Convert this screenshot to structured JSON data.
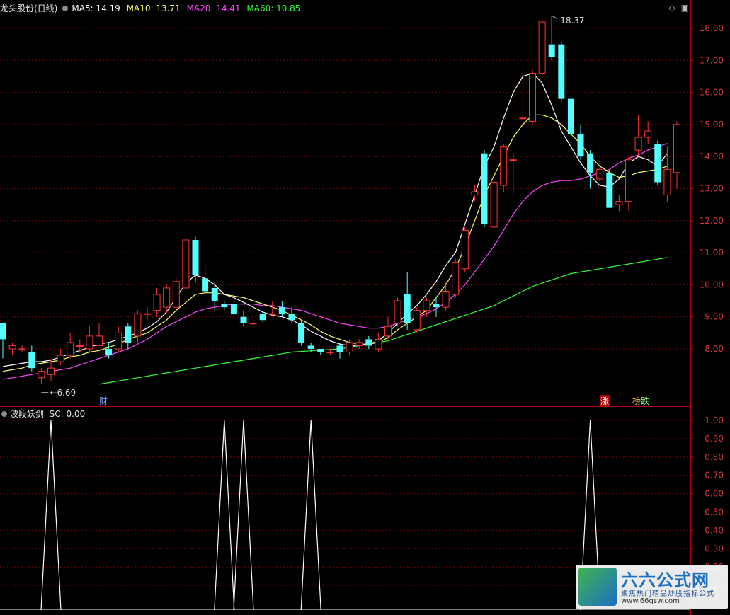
{
  "legend": {
    "title": "龙头股份(日线)",
    "ma5": "MA5: 14.19",
    "ma10": "MA10: 13.71",
    "ma20": "MA20: 14.41",
    "ma60": "MA60: 10.85"
  },
  "indicator": {
    "name": "波段妖剑",
    "value": "SC: 0.00"
  },
  "colors": {
    "up": "#ff3232",
    "down": "#54ffff",
    "ma5": "#ffffff",
    "ma10": "#ffff66",
    "ma20": "#ff44ff",
    "ma60": "#33ff33",
    "axis": "#b40000",
    "grid": "#7a0000",
    "tick_text": "#d63a3a"
  },
  "markers": {
    "high_label": "18.37",
    "low_label": "6.69",
    "tag_cai": "财",
    "tag_zhang": "涨",
    "tag_bang": "榜",
    "tag_die": "跌"
  },
  "watermark": {
    "title": "六六公式网",
    "subtitle": "聚焦热门精品炒股指标公式",
    "url": "www.66gsw.com"
  },
  "chart_data": [
    {
      "type": "candlestick",
      "title": "龙头股份(日线)",
      "ylim": [
        6.7,
        18.5
      ],
      "y_ticks": [
        "8.00",
        "9.00",
        "10.00",
        "11.00",
        "12.00",
        "13.00",
        "14.00",
        "15.00",
        "16.00",
        "17.00",
        "18.00"
      ],
      "candles": [
        [
          8.8,
          8.3,
          8.8,
          7.7
        ],
        [
          8.0,
          8.1,
          8.2,
          7.8
        ],
        [
          8.0,
          8.0,
          8.1,
          7.9
        ],
        [
          7.9,
          7.4,
          8.1,
          7.3
        ],
        [
          7.1,
          7.3,
          7.4,
          6.9
        ],
        [
          7.2,
          7.4,
          7.7,
          7.0
        ],
        [
          7.6,
          7.8,
          8.0,
          7.5
        ],
        [
          7.8,
          8.2,
          8.5,
          7.7
        ],
        [
          8.1,
          8.1,
          8.3,
          7.9
        ],
        [
          8.0,
          8.4,
          8.7,
          7.9
        ],
        [
          8.1,
          8.4,
          8.8,
          8.1
        ],
        [
          8.0,
          7.8,
          8.2,
          7.7
        ],
        [
          8.0,
          8.5,
          8.7,
          7.9
        ],
        [
          8.7,
          8.2,
          8.8,
          8.0
        ],
        [
          8.4,
          9.1,
          9.2,
          8.2
        ],
        [
          9.1,
          9.1,
          9.3,
          8.9
        ],
        [
          9.2,
          9.7,
          9.9,
          9.0
        ],
        [
          9.3,
          9.9,
          10.0,
          9.1
        ],
        [
          9.3,
          10.1,
          10.2,
          9.2
        ],
        [
          9.9,
          11.4,
          11.5,
          9.9
        ],
        [
          11.4,
          10.3,
          11.5,
          10.1
        ],
        [
          10.2,
          9.8,
          10.6,
          9.7
        ],
        [
          9.9,
          9.5,
          10.1,
          9.2
        ],
        [
          9.4,
          9.3,
          9.5,
          9.2
        ],
        [
          9.4,
          9.1,
          9.5,
          9.0
        ],
        [
          9.0,
          8.8,
          9.2,
          8.7
        ],
        [
          8.8,
          8.8,
          9.0,
          8.7
        ],
        [
          9.1,
          8.9,
          9.2,
          8.8
        ],
        [
          9.1,
          9.1,
          9.5,
          9.0
        ],
        [
          9.3,
          9.1,
          9.5,
          9.0
        ],
        [
          9.1,
          8.9,
          9.3,
          8.8
        ],
        [
          8.8,
          8.2,
          8.9,
          8.1
        ],
        [
          8.1,
          8.0,
          8.2,
          7.9
        ],
        [
          8.0,
          7.9,
          8.0,
          7.8
        ],
        [
          7.9,
          7.9,
          8.0,
          7.8
        ],
        [
          8.1,
          7.9,
          8.2,
          7.7
        ],
        [
          7.9,
          8.2,
          8.3,
          7.8
        ],
        [
          8.1,
          8.2,
          8.3,
          8.0
        ],
        [
          8.3,
          8.1,
          8.4,
          8.0
        ],
        [
          8.0,
          8.3,
          8.5,
          7.9
        ],
        [
          8.4,
          8.7,
          9.0,
          8.3
        ],
        [
          8.8,
          9.5,
          9.6,
          8.7
        ],
        [
          9.7,
          8.8,
          10.4,
          8.6
        ],
        [
          8.6,
          9.2,
          9.3,
          8.5
        ],
        [
          9.2,
          9.5,
          9.6,
          9.0
        ],
        [
          9.4,
          9.3,
          9.6,
          9.0
        ],
        [
          9.3,
          9.8,
          10.1,
          9.2
        ],
        [
          9.7,
          10.7,
          10.8,
          9.6
        ],
        [
          10.5,
          11.7,
          11.8,
          10.4
        ],
        [
          12.8,
          12.9,
          13.1,
          12.6
        ],
        [
          14.1,
          11.9,
          14.2,
          11.8
        ],
        [
          11.8,
          13.2,
          13.3,
          11.7
        ],
        [
          13.1,
          14.3,
          14.4,
          12.9
        ],
        [
          13.9,
          13.9,
          14.1,
          12.8
        ],
        [
          15.2,
          15.2,
          16.8,
          14.9
        ],
        [
          15.1,
          16.6,
          16.7,
          15.0
        ],
        [
          16.6,
          18.2,
          18.3,
          16.4
        ],
        [
          17.5,
          17.1,
          18.4,
          17.0
        ],
        [
          17.5,
          15.8,
          17.6,
          15.7
        ],
        [
          15.8,
          14.7,
          15.9,
          14.6
        ],
        [
          14.7,
          14.0,
          15.0,
          13.9
        ],
        [
          14.1,
          13.5,
          14.2,
          13.0
        ],
        [
          13.3,
          13.6,
          13.9,
          13.2
        ],
        [
          13.5,
          12.4,
          13.6,
          12.4
        ],
        [
          12.5,
          12.6,
          12.8,
          12.3
        ],
        [
          12.6,
          13.9,
          14.0,
          12.3
        ],
        [
          14.2,
          14.6,
          15.3,
          14.0
        ],
        [
          14.6,
          14.8,
          15.1,
          14.4
        ],
        [
          14.4,
          13.2,
          14.5,
          13.1
        ],
        [
          12.8,
          13.6,
          14.3,
          12.6
        ],
        [
          13.5,
          15.0,
          15.1,
          13.0
        ]
      ],
      "ma5": [
        7.45,
        7.5,
        7.55,
        7.6,
        7.6,
        7.65,
        7.75,
        7.85,
        7.95,
        8.05,
        8.15,
        8.2,
        8.3,
        8.4,
        8.5,
        8.65,
        8.85,
        9.15,
        9.6,
        10.05,
        10.3,
        10.2,
        10.0,
        9.7,
        9.6,
        9.45,
        9.3,
        9.15,
        9.05,
        9.0,
        8.9,
        8.75,
        8.55,
        8.4,
        8.25,
        8.15,
        8.1,
        8.1,
        8.15,
        8.25,
        8.5,
        8.8,
        9.1,
        9.35,
        9.7,
        10.1,
        10.6,
        11.0,
        11.9,
        12.8,
        13.7,
        14.3,
        15.2,
        16.0,
        16.5,
        16.6,
        16.3,
        15.6,
        14.8,
        14.3,
        13.8,
        13.4,
        13.1,
        13.05,
        13.3,
        13.8,
        14.0,
        13.9,
        13.7,
        14.1
      ],
      "ma10": [
        7.3,
        7.35,
        7.4,
        7.5,
        7.55,
        7.6,
        7.65,
        7.75,
        7.8,
        7.9,
        7.95,
        8.05,
        8.15,
        8.3,
        8.4,
        8.5,
        8.7,
        8.9,
        9.2,
        9.45,
        9.7,
        9.75,
        9.75,
        9.7,
        9.65,
        9.6,
        9.5,
        9.4,
        9.3,
        9.2,
        9.05,
        8.9,
        8.75,
        8.55,
        8.4,
        8.3,
        8.2,
        8.15,
        8.15,
        8.2,
        8.35,
        8.6,
        8.8,
        9.0,
        9.2,
        9.6,
        10.0,
        10.5,
        11.2,
        12.0,
        12.8,
        13.4,
        14.0,
        14.6,
        15.0,
        15.3,
        15.3,
        15.2,
        15.0,
        14.7,
        14.4,
        14.0,
        13.7,
        13.5,
        13.35,
        13.4,
        13.5,
        13.55,
        13.6,
        13.7
      ],
      "ma20": [
        7.05,
        7.1,
        7.15,
        7.2,
        7.25,
        7.3,
        7.35,
        7.4,
        7.5,
        7.6,
        7.7,
        7.8,
        7.9,
        8.0,
        8.15,
        8.3,
        8.5,
        8.7,
        8.85,
        9.0,
        9.15,
        9.25,
        9.3,
        9.35,
        9.4,
        9.4,
        9.4,
        9.35,
        9.35,
        9.3,
        9.25,
        9.2,
        9.1,
        9.0,
        8.9,
        8.8,
        8.75,
        8.7,
        8.65,
        8.65,
        8.7,
        8.8,
        8.9,
        9.0,
        9.1,
        9.25,
        9.45,
        9.7,
        10.0,
        10.4,
        10.8,
        11.2,
        11.7,
        12.2,
        12.6,
        12.9,
        13.1,
        13.2,
        13.25,
        13.25,
        13.3,
        13.4,
        13.5,
        13.6,
        13.8,
        13.95,
        14.05,
        14.2,
        14.3,
        14.41
      ],
      "ma60": [
        null,
        null,
        null,
        null,
        null,
        null,
        null,
        null,
        null,
        null,
        6.9,
        6.95,
        7.0,
        7.05,
        7.1,
        7.15,
        7.2,
        7.25,
        7.3,
        7.35,
        7.4,
        7.45,
        7.5,
        7.55,
        7.6,
        7.65,
        7.7,
        7.75,
        7.8,
        7.85,
        7.9,
        7.92,
        7.94,
        7.96,
        7.98,
        8.0,
        8.05,
        8.1,
        8.15,
        8.2,
        8.25,
        8.35,
        8.45,
        8.55,
        8.65,
        8.75,
        8.85,
        8.95,
        9.05,
        9.15,
        9.25,
        9.35,
        9.5,
        9.65,
        9.8,
        9.95,
        10.05,
        10.15,
        10.25,
        10.35,
        10.4,
        10.45,
        10.5,
        10.55,
        10.6,
        10.65,
        10.7,
        10.75,
        10.8,
        10.85
      ],
      "annotations": [
        "18.37",
        "6.69"
      ]
    },
    {
      "type": "line",
      "title": "波段妖剑",
      "series_name": "SC",
      "ylim": [
        0,
        1.0
      ],
      "y_ticks": [
        "0.10",
        "0.20",
        "0.30",
        "0.40",
        "0.50",
        "0.60",
        "0.70",
        "0.80",
        "0.90",
        "1.00"
      ],
      "spike_bars": [
        5,
        23,
        25,
        32,
        61
      ],
      "values_note": "0 everywhere except 1.00 at spike bars"
    }
  ]
}
